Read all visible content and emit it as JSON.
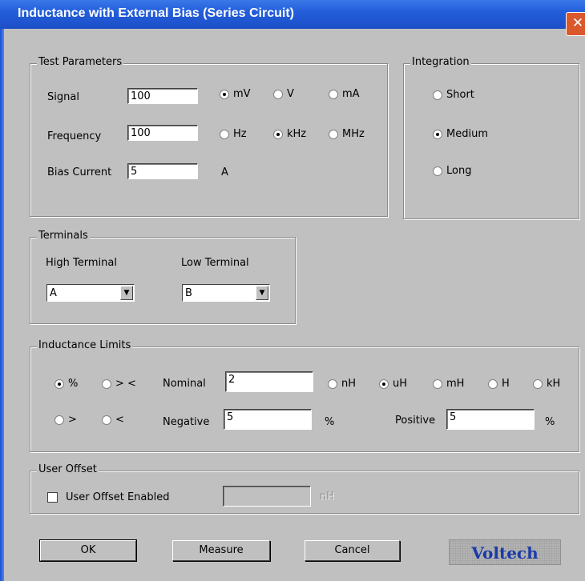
{
  "window": {
    "title": "Inductance with External Bias (Series Circuit)",
    "close_glyph": "✕"
  },
  "test_parameters": {
    "legend": "Test Parameters",
    "signal": {
      "label": "Signal",
      "value": "100",
      "units": [
        "mV",
        "V",
        "mA"
      ],
      "selected": "mV"
    },
    "frequency": {
      "label": "Frequency",
      "value": "100",
      "units": [
        "Hz",
        "kHz",
        "MHz"
      ],
      "selected": "kHz"
    },
    "bias_current": {
      "label": "Bias Current",
      "value": "5",
      "unit": "A"
    }
  },
  "integration": {
    "legend": "Integration",
    "options": [
      "Short",
      "Medium",
      "Long"
    ],
    "selected": "Medium"
  },
  "terminals": {
    "legend": "Terminals",
    "high": {
      "label": "High Terminal",
      "value": "A"
    },
    "low": {
      "label": "Low Terminal",
      "value": "B"
    }
  },
  "limits": {
    "legend": "Inductance Limits",
    "modes": [
      "%",
      "> <",
      ">",
      "<"
    ],
    "selected_mode": "%",
    "nominal": {
      "label": "Nominal",
      "value": "2"
    },
    "units": [
      "nH",
      "uH",
      "mH",
      "H",
      "kH"
    ],
    "selected_unit": "uH",
    "negative": {
      "label": "Negative",
      "value": "5",
      "unit": "%"
    },
    "positive": {
      "label": "Positive",
      "value": "5",
      "unit": "%"
    }
  },
  "user_offset": {
    "legend": "User Offset",
    "checkbox_label": "User Offset Enabled",
    "enabled": false,
    "value": "",
    "unit": "nH"
  },
  "buttons": {
    "ok": "OK",
    "measure": "Measure",
    "cancel": "Cancel"
  },
  "logo": "Voltech"
}
